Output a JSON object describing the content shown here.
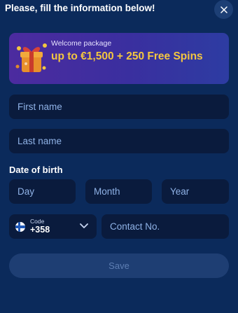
{
  "header": {
    "title": "Please, fill the information below!"
  },
  "promo": {
    "small_text": "Welcome package",
    "big_text": "up to €1,500 + 250 Free Spins"
  },
  "form": {
    "first_name_placeholder": "First name",
    "last_name_placeholder": "Last name",
    "dob_label": "Date of birth",
    "day_placeholder": "Day",
    "month_placeholder": "Month",
    "year_placeholder": "Year",
    "phone_code_label": "Code",
    "phone_code_value": "+358",
    "contact_placeholder": "Contact No.",
    "save_label": "Save"
  },
  "colors": {
    "background": "#0b2a5b",
    "field": "#0a1b3d",
    "promo_accent": "#f3c640",
    "button_disabled": "#1e3e73"
  },
  "icons": [
    "close-icon",
    "gift-box-icon",
    "finland-flag-icon",
    "chevron-down-icon"
  ]
}
